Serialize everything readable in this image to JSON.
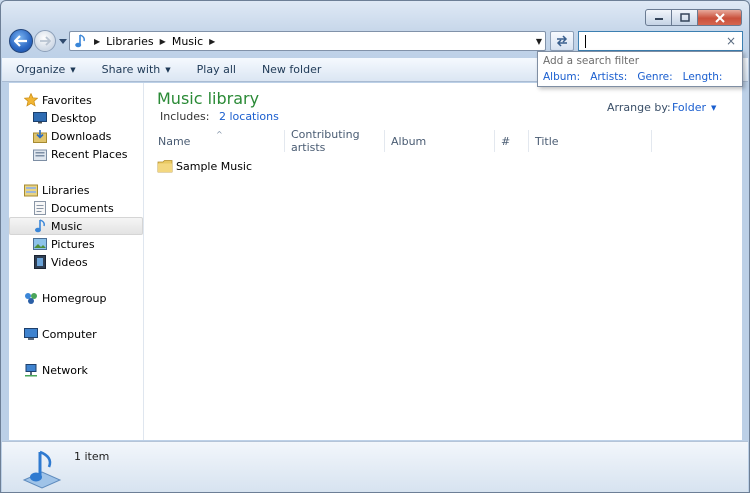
{
  "window": {
    "caption_buttons": {
      "minimize": "minimize",
      "maximize": "maximize",
      "close": "close"
    }
  },
  "nav": {
    "breadcrumb": [
      "Libraries",
      "Music"
    ],
    "search": {
      "value": "",
      "clear_glyph": "×"
    }
  },
  "search_dropdown": {
    "hint": "Add a search filter",
    "filters": [
      "Album:",
      "Artists:",
      "Genre:",
      "Length:"
    ]
  },
  "toolbar": {
    "organize": "Organize",
    "share_with": "Share with",
    "play_all": "Play all",
    "new_folder": "New folder"
  },
  "sidebar": {
    "favorites": {
      "label": "Favorites",
      "items": [
        "Desktop",
        "Downloads",
        "Recent Places"
      ]
    },
    "libraries": {
      "label": "Libraries",
      "items": [
        "Documents",
        "Music",
        "Pictures",
        "Videos"
      ],
      "selected": "Music"
    },
    "homegroup": "Homegroup",
    "computer": "Computer",
    "network": "Network"
  },
  "main": {
    "title": "Music library",
    "includes_label": "Includes:",
    "includes_link": "2 locations",
    "arrange_label": "Arrange by:",
    "arrange_value": "Folder",
    "columns": [
      "Name",
      "Contributing artists",
      "Album",
      "#",
      "Title"
    ],
    "items": [
      {
        "name": "Sample Music",
        "type": "folder"
      }
    ]
  },
  "status": {
    "text": "1 item"
  },
  "colors": {
    "title_green": "#2a8a36",
    "link_blue": "#1a5ecf",
    "close_red": "#c9503b"
  }
}
